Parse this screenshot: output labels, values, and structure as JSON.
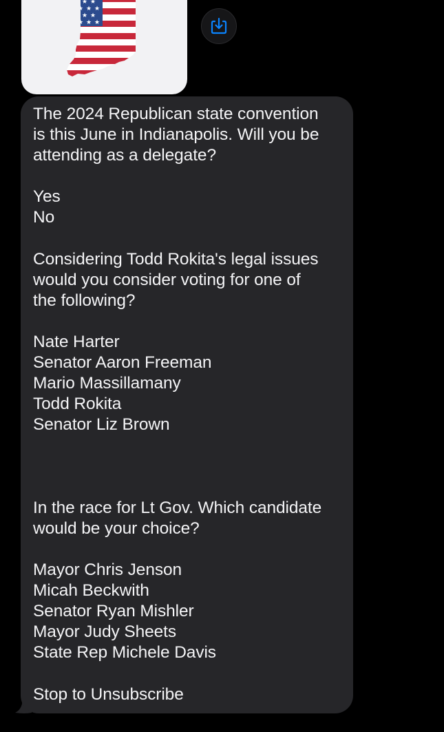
{
  "attachment": {
    "image_subject": "indiana-flag-map",
    "colors": {
      "canton": "#2c4b8e",
      "stripe_red": "#c8283a",
      "stripe_white": "#ffffff",
      "bubble_bg": "#f2f2f4"
    }
  },
  "save_button": {
    "icon": "square-arrow-down-icon",
    "accent": "#0a84ff"
  },
  "message": {
    "lines": [
      "The 2024 Republican state convention",
      "is this June in Indianapolis. Will you be",
      "attending as a delegate?",
      "",
      "Yes",
      "No",
      "",
      "Considering Todd Rokita's legal issues",
      "would you consider voting for one of",
      "the following?",
      "",
      "Nate Harter",
      "Senator Aaron Freeman",
      "Mario Massillamany",
      "Todd Rokita",
      "Senator Liz Brown",
      "",
      "",
      "",
      "In the race for Lt Gov. Which candidate",
      "would be your choice?",
      "",
      "Mayor Chris Jenson",
      "Micah Beckwith",
      "Senator Ryan Mishler",
      "Mayor Judy Sheets",
      "State Rep Michele Davis",
      "",
      "Stop to Unsubscribe"
    ]
  },
  "theme": {
    "background": "#000000",
    "bubble": "#262629",
    "text": "#f4f4f6"
  }
}
